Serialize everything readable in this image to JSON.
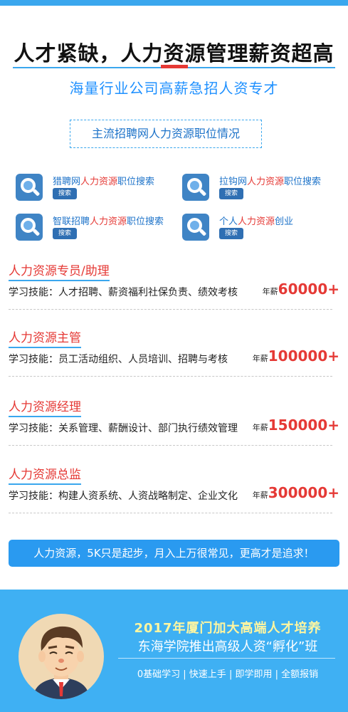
{
  "header": {
    "headline": "人才紧缺，人力资源管理薪资超高",
    "subhead": "海量行业公司高薪急招人资专才",
    "section_label": "主流招聘网人力资源职位情况"
  },
  "search_items": [
    {
      "prefix": "猎聘网",
      "highlight": "人力资源",
      "suffix": "职位搜索",
      "button": "搜索"
    },
    {
      "prefix": "拉钩网",
      "highlight": "人力资源",
      "suffix": "职位搜索",
      "button": "搜索"
    },
    {
      "prefix": "智联招聘",
      "highlight": "人力资源",
      "suffix": "职位搜索",
      "button": "搜索"
    },
    {
      "prefix": "个人",
      "highlight": "人力资源",
      "suffix": "创业",
      "button": "搜索"
    }
  ],
  "jobs": [
    {
      "title": "人力资源专员/助理",
      "skills": "学习技能：人才招聘、薪资福利社保负责、绩效考核",
      "salary_label": "年薪",
      "salary": "60000+"
    },
    {
      "title": "人力资源主管",
      "skills": "学习技能：员工活动组织、人员培训、招聘与考核",
      "salary_label": "年薪",
      "salary": "100000+"
    },
    {
      "title": "人力资源经理",
      "skills": "学习技能：关系管理、薪酬设计、部门执行绩效管理",
      "salary_label": "年薪",
      "salary": "150000+"
    },
    {
      "title": "人力资源总监",
      "skills": "学习技能：构建人资系统、人资战略制定、企业文化",
      "salary_label": "年薪",
      "salary": "300000+"
    }
  ],
  "banner": {
    "text": "人力资源，5K只是起步，月入上万很常见，更高才是追求！"
  },
  "footer": {
    "line1": "2017年厦门加大高端人才培养",
    "line2": "东海学院推出高级人资“孵化”班",
    "line3": "0基础学习 | 快速上手 | 即学即用 | 全额报销"
  },
  "colors": {
    "accent_blue": "#3aa7ee",
    "highlight_red": "#e53935",
    "footer_blue": "#3fb0f3"
  }
}
